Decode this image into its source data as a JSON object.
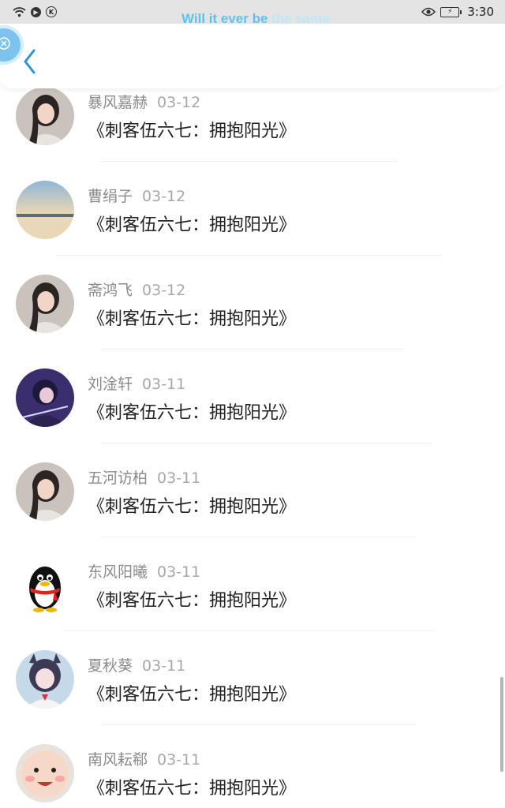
{
  "status_bar": {
    "marquee_part1": "Will it ever be ",
    "marquee_part2": "the same",
    "time": "3:30",
    "marquee_colors": [
      "#5cc3ee",
      "#bfe6f6"
    ]
  },
  "header": {
    "back_icon": "chevron-left-icon",
    "accent": "#2f8fe0"
  },
  "items": [
    {
      "name": "暴风嘉赫",
      "date": "03-12",
      "title": "《刺客伍六七：拥抱阳光》",
      "avatar": "girl-photo"
    },
    {
      "name": "曹绢子",
      "date": "03-12",
      "title": "《刺客伍六七：拥抱阳光》",
      "avatar": "sunset-photo"
    },
    {
      "name": "斋鸿飞",
      "date": "03-12",
      "title": "《刺客伍六七：拥抱阳光》",
      "avatar": "girl-photo"
    },
    {
      "name": "刘淦轩",
      "date": "03-11",
      "title": "《刺客伍六七：拥抱阳光》",
      "avatar": "anime-ninja"
    },
    {
      "name": "五河访柏",
      "date": "03-11",
      "title": "《刺客伍六七：拥抱阳光》",
      "avatar": "girl-photo"
    },
    {
      "name": "东风阳曦",
      "date": "03-11",
      "title": "《刺客伍六七：拥抱阳光》",
      "avatar": "qq-penguin"
    },
    {
      "name": "夏秋葵",
      "date": "03-11",
      "title": "《刺客伍六七：拥抱阳光》",
      "avatar": "anime-girl"
    },
    {
      "name": "南风耘郗",
      "date": "03-11",
      "title": "《刺客伍六七：拥抱阳光》",
      "avatar": "baby-face"
    }
  ]
}
